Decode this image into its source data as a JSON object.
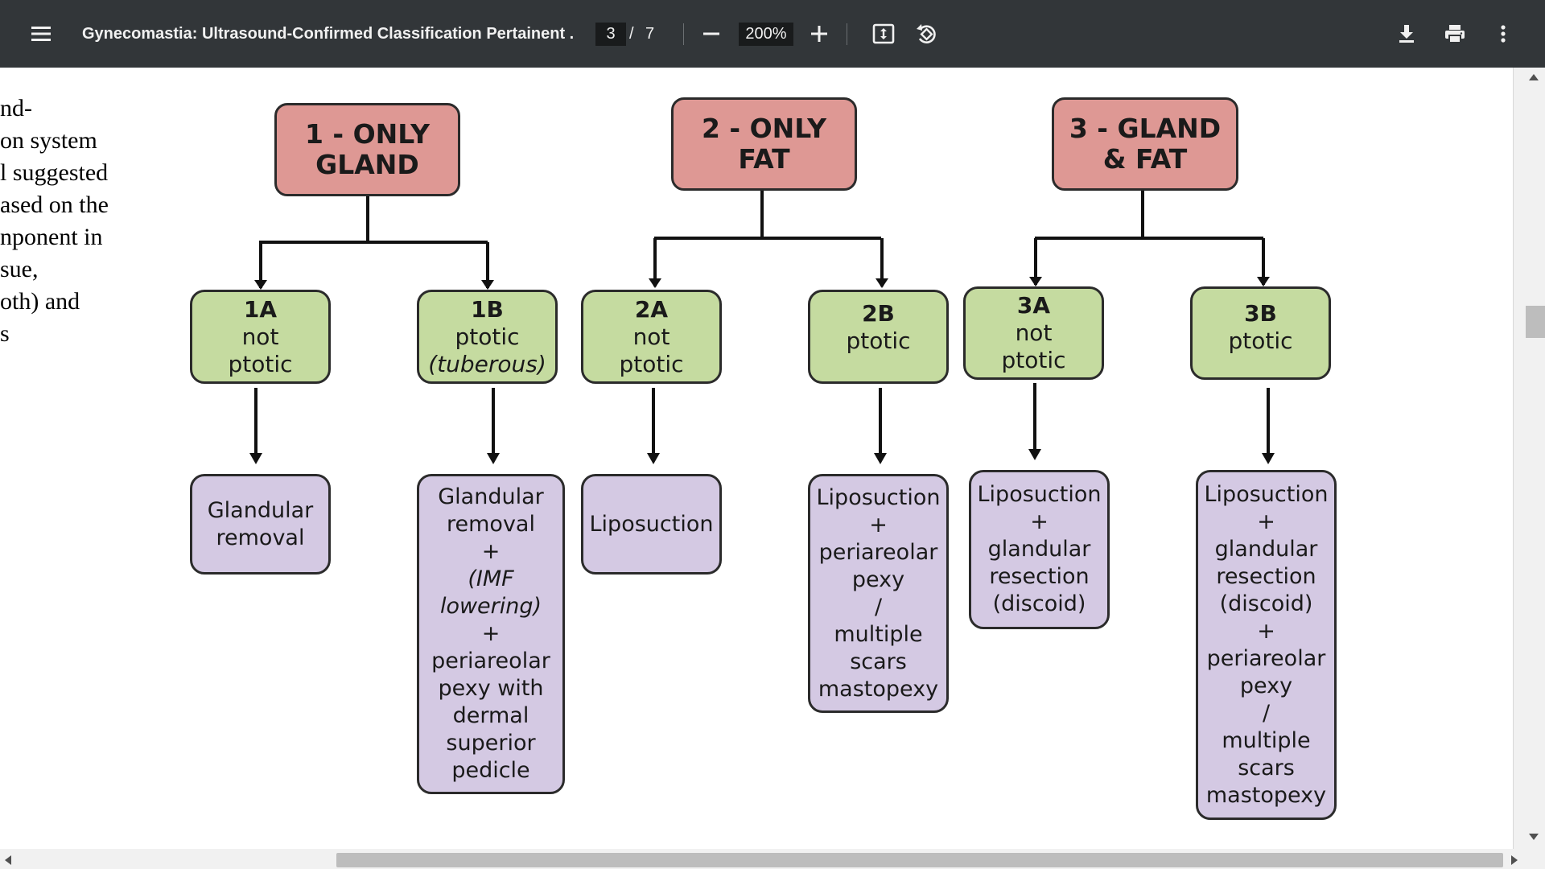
{
  "toolbar": {
    "title": "Gynecomastia: Ultrasound-Confirmed Classification Pertainent ...",
    "page_current": "3",
    "page_separator": "/",
    "page_total": "7",
    "zoom": "200%",
    "icons": [
      "menu-icon",
      "zoom-out-icon",
      "zoom-in-icon",
      "fit-page-icon",
      "rotate-icon",
      "download-icon",
      "print-icon",
      "more-vert-icon"
    ]
  },
  "side_text": {
    "lines": [
      "nd-",
      "on system",
      "l suggested",
      "ased on the",
      "nponent in",
      "sue,",
      "oth) and",
      "s"
    ]
  },
  "diagram": {
    "top": [
      {
        "lines": [
          "1 - ONLY",
          "GLAND"
        ]
      },
      {
        "lines": [
          "2 - ONLY",
          "FAT"
        ]
      },
      {
        "lines": [
          "3 - GLAND",
          "& FAT"
        ]
      }
    ],
    "mid": [
      {
        "code": "1A",
        "lines": [
          "not",
          "ptotic"
        ]
      },
      {
        "code": "1B",
        "lines": [
          "ptotic",
          "(tuberous)"
        ]
      },
      {
        "code": "2A",
        "lines": [
          "not",
          "ptotic"
        ]
      },
      {
        "code": "2B",
        "lines": [
          "ptotic"
        ]
      },
      {
        "code": "3A",
        "lines": [
          "not",
          "ptotic"
        ]
      },
      {
        "code": "3B",
        "lines": [
          "ptotic"
        ]
      }
    ],
    "leaf": [
      {
        "lines": [
          "Glandular",
          "removal"
        ]
      },
      {
        "lines": [
          "Glandular",
          "removal",
          "+",
          "(IMF",
          "lowering)",
          "+",
          "periareolar",
          "pexy with",
          "dermal",
          "superior",
          "pedicle"
        ]
      },
      {
        "lines": [
          "Liposuction"
        ]
      },
      {
        "lines": [
          "Liposuction",
          "+",
          "periareolar",
          "pexy",
          "/",
          "multiple",
          "scars",
          "mastopexy"
        ]
      },
      {
        "lines": [
          "Liposuction",
          "+",
          "glandular",
          "resection",
          "(discoid)"
        ]
      },
      {
        "lines": [
          "Liposuction",
          "+",
          "glandular",
          "resection",
          "(discoid)",
          "+",
          "periareolar",
          "pexy",
          "/",
          "multiple",
          "scars",
          "mastopexy"
        ]
      }
    ]
  }
}
